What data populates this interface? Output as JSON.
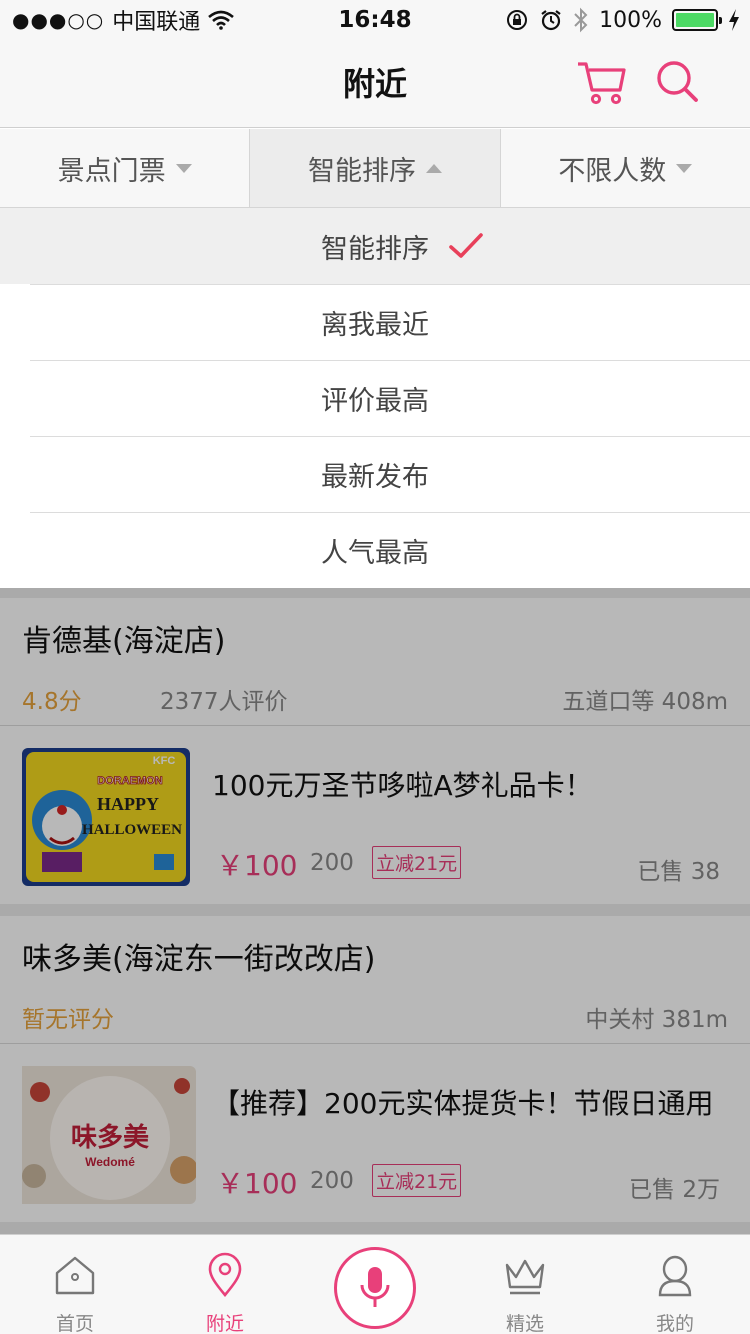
{
  "status_bar": {
    "signal": "●●●○○",
    "carrier": "中国联通",
    "time": "16:48",
    "battery_percent": "100%",
    "battery_level": 1.0
  },
  "nav": {
    "title": "附近",
    "cart_icon": "cart-icon",
    "search_icon": "search-icon"
  },
  "filters": [
    {
      "label": "景点门票",
      "state": "collapsed"
    },
    {
      "label": "智能排序",
      "state": "expanded"
    },
    {
      "label": "不限人数",
      "state": "collapsed"
    }
  ],
  "sort_menu": {
    "selected": "智能排序",
    "items": [
      "智能排序",
      "离我最近",
      "评价最高",
      "最新发布",
      "人气最高"
    ]
  },
  "shops": [
    {
      "name": "肯德基(海淀店)",
      "rating": "4.8分",
      "reviews": "2377人评价",
      "location": "五道口等 408m",
      "deal": {
        "title": "100元万圣节哆啦A梦礼品卡！",
        "price": "￥100",
        "original_price": "200",
        "promo": "立减21元",
        "sold": "已售 38",
        "image_text": {
          "brand": "KFC",
          "line1": "DORAEMON",
          "line2": "HAPPY",
          "line3": "HALLOWEEN"
        }
      }
    },
    {
      "name": "味多美(海淀东一街改改店)",
      "rating": "暂无评分",
      "reviews": "",
      "location": "中关村 381m",
      "deal": {
        "title": "【推荐】200元实体提货卡！节假日通用",
        "price": "￥100",
        "original_price": "200",
        "promo": "立减21元",
        "sold": "已售 2万",
        "image_text": {
          "brand_cn": "味多美",
          "brand_en": "Wedomé"
        }
      }
    }
  ],
  "tab_bar": {
    "tabs": [
      {
        "label": "首页",
        "icon": "home-icon"
      },
      {
        "label": "附近",
        "icon": "location-pin-icon"
      },
      {
        "label": "精选",
        "icon": "crown-icon"
      },
      {
        "label": "我的",
        "icon": "user-icon"
      }
    ],
    "active": "附近",
    "center_icon": "microphone-icon"
  },
  "colors": {
    "accent": "#e8407a",
    "rating": "#e6a23c",
    "check": "#e8405a",
    "battery": "#4cd964"
  }
}
